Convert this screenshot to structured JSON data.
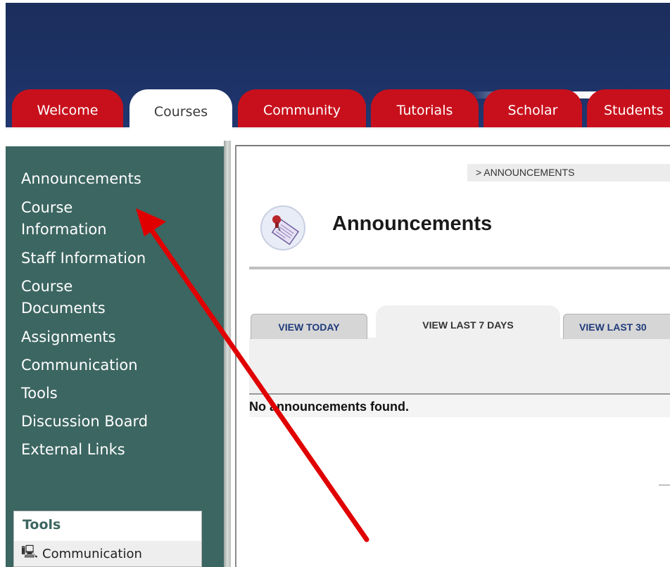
{
  "top_tabs": [
    {
      "label": "Welcome",
      "active": false
    },
    {
      "label": "Courses",
      "active": true
    },
    {
      "label": "Community",
      "active": false
    },
    {
      "label": "Tutorials",
      "active": false
    },
    {
      "label": "Scholar",
      "active": false
    },
    {
      "label": "Students",
      "active": false
    }
  ],
  "course_menu": {
    "items": [
      {
        "label": "Announcements"
      },
      {
        "label": "Course"
      },
      {
        "label": "Information"
      },
      {
        "label": "Staff Information"
      },
      {
        "label": "Course"
      },
      {
        "label": "Documents"
      },
      {
        "label": "Assignments"
      },
      {
        "label": "Communication"
      },
      {
        "label": "Tools"
      },
      {
        "label": "Discussion Board"
      },
      {
        "label": "External Links"
      }
    ]
  },
  "tools_panel": {
    "title": "Tools",
    "rows": [
      {
        "label": "Communication",
        "icon": "computer-icon"
      }
    ]
  },
  "breadcrumb": "> ANNOUNCEMENTS",
  "page_title": "Announcements",
  "page_icon": "announcement-pushpin-icon",
  "view_tabs": [
    {
      "label": "VIEW TODAY",
      "active": false
    },
    {
      "label": "VIEW LAST 7 DAYS",
      "active": true
    },
    {
      "label": "VIEW LAST 30",
      "active": false
    }
  ],
  "empty_message": "No announcements found.",
  "colors": {
    "banner": "#1d3266",
    "tab_red": "#c8101c",
    "sidebar_teal": "#3c6661",
    "annotation_arrow": "#e00000"
  }
}
